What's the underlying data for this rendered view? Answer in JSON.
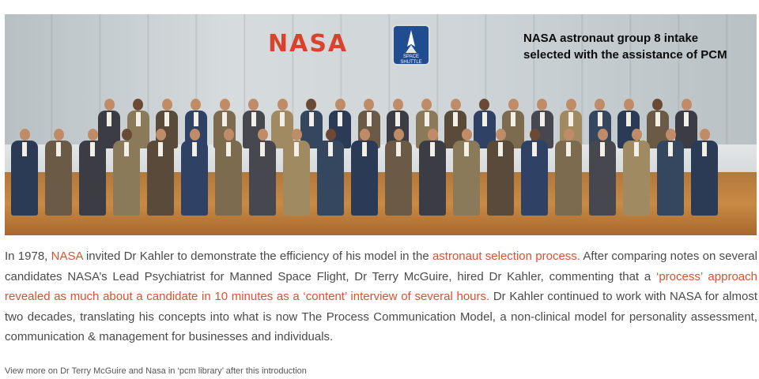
{
  "photo": {
    "nasa_logo_text": "NASA",
    "emblem_text": "SPACE SHUTTLE",
    "caption_line1": "NASA astronaut group 8 intake",
    "caption_line2": "selected with the assistance of PCM"
  },
  "article": {
    "t1": "In 1978, ",
    "link_nasa": "NASA",
    "t2": " invited Dr Kahler to demonstrate the efficiency of his model in the ",
    "link_astronaut": "astronaut selection process.",
    "t3": " After comparing notes on several candidates NASA’s Lead Psychiatrist for Manned Space Flight, Dr Terry McGuire, hired Dr Kahler, commenting that a ",
    "link_quote": "‘process’ approach revealed as much about a candidate in 10 minutes as a ‘content’ interview of several hours.",
    "t4": " Dr Kahler continued to work with NASA for almost two decades, translating his concepts into what is now The Process Communication Model, a non-clinical model for personality assessment, communication & management for businesses and individuals."
  },
  "footnote": "View more on Dr Terry McGuire and Nasa in ‘pcm library’ after this introduction",
  "colors": {
    "link": "#d9522f",
    "nasa_red": "#d9422b",
    "caption_text": "#0b0b0b",
    "body_text": "#4a4a4a"
  }
}
